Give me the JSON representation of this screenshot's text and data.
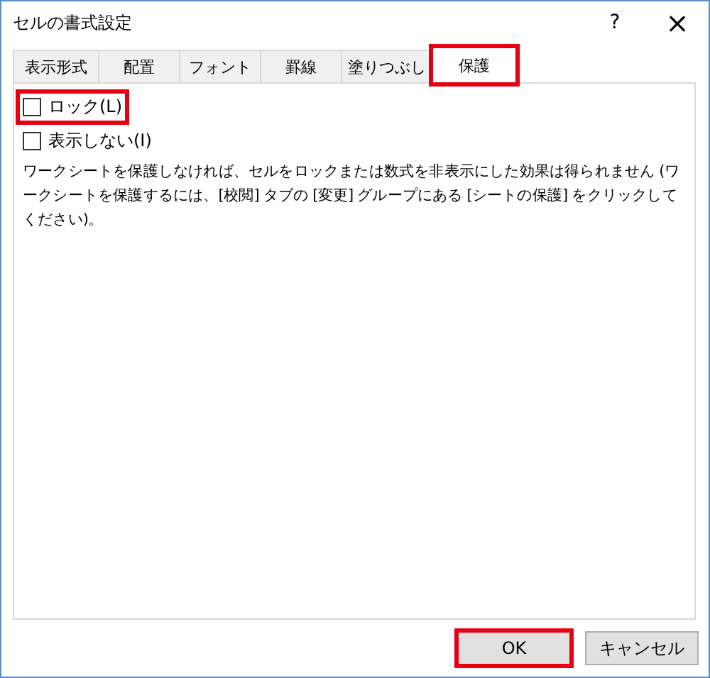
{
  "window": {
    "title": "セルの書式設定",
    "help": "?",
    "close": "×"
  },
  "tabs": [
    {
      "label": "表示形式",
      "selected": false,
      "highlighted": false
    },
    {
      "label": "配置",
      "selected": false,
      "highlighted": false
    },
    {
      "label": "フォント",
      "selected": false,
      "highlighted": false
    },
    {
      "label": "罫線",
      "selected": false,
      "highlighted": false
    },
    {
      "label": "塗りつぶし",
      "selected": false,
      "highlighted": false
    },
    {
      "label": "保護",
      "selected": true,
      "highlighted": true
    }
  ],
  "options": [
    {
      "label": "ロック(L)",
      "checked": false,
      "highlighted": true
    },
    {
      "label": "表示しない(I)",
      "checked": false,
      "highlighted": false
    }
  ],
  "description": "ワークシートを保護しなければ、セルをロックまたは数式を非表示にした効果は得られません (ワークシートを保護するには、[校閲] タブの [変更] グループにある [シートの保護] をクリックしてください)。",
  "buttons": [
    {
      "label": "OK",
      "highlighted": true
    },
    {
      "label": "キャンセル",
      "highlighted": false
    }
  ]
}
